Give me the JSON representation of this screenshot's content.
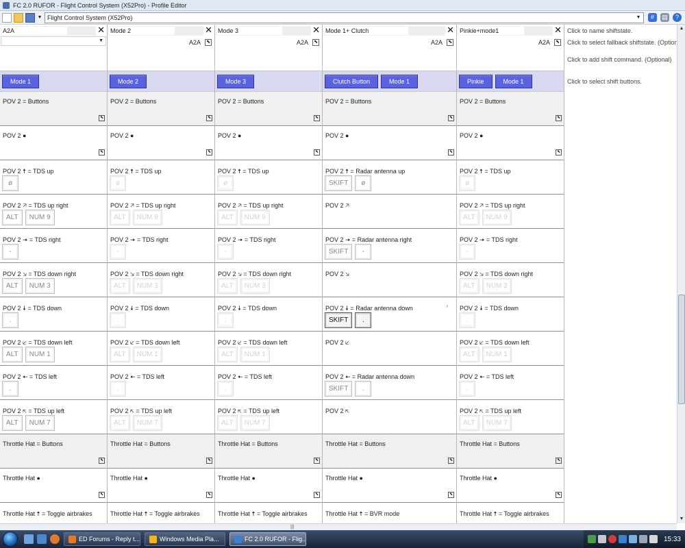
{
  "window": {
    "title": "FC 2.0 RUFOR - Flight Control System (X52Pro) - Profile Editor"
  },
  "toolbar": {
    "profile": "Flight Control System (X52Pro)",
    "icons": [
      "new-file-icon",
      "open-folder-icon",
      "save-icon",
      "dropdown-icon",
      "keyboard-icon",
      "print-icon",
      "help-icon"
    ]
  },
  "info": {
    "name": "Click to name shiftstate.",
    "fallback": "Click to select fallback shiftstate. (Optional)",
    "command": "Click to add shift command. (Optional)",
    "buttons": "Click to select shift buttons."
  },
  "columns": [
    {
      "name": "A2A",
      "fallback": "",
      "shift": [
        "Mode 1"
      ],
      "cells": [
        {
          "label": "POV 2 = Buttons",
          "keys": []
        },
        {
          "label": "POV 2 ●",
          "keys": []
        },
        {
          "label": "POV 2 🠅 = TDS up",
          "keys": [
            {
              "t": "ø",
              "s": "n"
            }
          ]
        },
        {
          "label": "POV 2 🡥 = TDS up right",
          "keys": [
            {
              "t": "ALT",
              "s": "n"
            },
            {
              "t": "NUM 9",
              "s": "n"
            }
          ]
        },
        {
          "label": "POV 2 🠆 = TDS right",
          "keys": [
            {
              "t": "-",
              "s": "n"
            }
          ]
        },
        {
          "label": "POV 2 🡦 = TDS down right",
          "keys": [
            {
              "t": "ALT",
              "s": "n"
            },
            {
              "t": "NUM 3",
              "s": "n"
            }
          ]
        },
        {
          "label": "POV 2 🠇 = TDS down",
          "keys": [
            {
              "t": ".",
              "s": "n"
            }
          ]
        },
        {
          "label": "POV 2 🡧 = TDS down left",
          "keys": [
            {
              "t": "ALT",
              "s": "n"
            },
            {
              "t": "NUM 1",
              "s": "n"
            }
          ]
        },
        {
          "label": "POV 2 🠄 = TDS left",
          "keys": [
            {
              "t": ".",
              "s": "n"
            }
          ]
        },
        {
          "label": "POV 2 🡤 = TDS up left",
          "keys": [
            {
              "t": "ALT",
              "s": "n"
            },
            {
              "t": "NUM 7",
              "s": "n"
            }
          ]
        },
        {
          "label": "Throttle Hat = Buttons",
          "keys": []
        },
        {
          "label": "Throttle Hat ●",
          "keys": []
        },
        {
          "label": "Throttle Hat 🠅 = Toggle airbrakes",
          "keys": []
        }
      ]
    },
    {
      "name": "Mode 2",
      "fallback": "A2A",
      "shift": [
        "Mode 2"
      ],
      "cells": [
        {
          "label": "POV 2 = Buttons",
          "keys": []
        },
        {
          "label": "POV 2 ●",
          "keys": []
        },
        {
          "label": "POV 2 🠅 = TDS up",
          "keys": [
            {
              "t": "ø",
              "s": "f"
            }
          ]
        },
        {
          "label": "POV 2 🡥 = TDS up right",
          "keys": [
            {
              "t": "ALT",
              "s": "f"
            },
            {
              "t": "NUM 9",
              "s": "f"
            }
          ]
        },
        {
          "label": "POV 2 🠆 = TDS right",
          "keys": [
            {
              "t": "-",
              "s": "f"
            }
          ]
        },
        {
          "label": "POV 2 🡦 = TDS down right",
          "keys": [
            {
              "t": "ALT",
              "s": "f"
            },
            {
              "t": "NUM 3",
              "s": "f"
            }
          ]
        },
        {
          "label": "POV 2 🠇 = TDS down",
          "keys": [
            {
              "t": ".",
              "s": "f"
            }
          ]
        },
        {
          "label": "POV 2 🡧 = TDS down left",
          "keys": [
            {
              "t": "ALT",
              "s": "f"
            },
            {
              "t": "NUM 1",
              "s": "f"
            }
          ]
        },
        {
          "label": "POV 2 🠄 = TDS left",
          "keys": [
            {
              "t": ".",
              "s": "f"
            }
          ]
        },
        {
          "label": "POV 2 🡤 = TDS up left",
          "keys": [
            {
              "t": "ALT",
              "s": "f"
            },
            {
              "t": "NUM 7",
              "s": "f"
            }
          ]
        },
        {
          "label": "Throttle Hat = Buttons",
          "keys": []
        },
        {
          "label": "Throttle Hat ●",
          "keys": []
        },
        {
          "label": "Throttle Hat 🠅 = Toggle airbrakes",
          "keys": []
        }
      ]
    },
    {
      "name": "Mode 3",
      "fallback": "A2A",
      "shift": [
        "Mode 3"
      ],
      "cells": [
        {
          "label": "POV 2 = Buttons",
          "keys": []
        },
        {
          "label": "POV 2 ●",
          "keys": []
        },
        {
          "label": "POV 2 🠅 = TDS up",
          "keys": [
            {
              "t": "ø",
              "s": "f"
            }
          ]
        },
        {
          "label": "POV 2 🡥 = TDS up right",
          "keys": [
            {
              "t": "ALT",
              "s": "f"
            },
            {
              "t": "NUM 9",
              "s": "f"
            }
          ]
        },
        {
          "label": "POV 2 🠆 = TDS right",
          "keys": [
            {
              "t": "-",
              "s": "f"
            }
          ]
        },
        {
          "label": "POV 2 🡦 = TDS down right",
          "keys": [
            {
              "t": "ALT",
              "s": "f"
            },
            {
              "t": "NUM 3",
              "s": "f"
            }
          ]
        },
        {
          "label": "POV 2 🠇 = TDS down",
          "keys": [
            {
              "t": ".",
              "s": "f"
            }
          ]
        },
        {
          "label": "POV 2 🡧 = TDS down left",
          "keys": [
            {
              "t": "ALT",
              "s": "f"
            },
            {
              "t": "NUM 1",
              "s": "f"
            }
          ]
        },
        {
          "label": "POV 2 🠄 = TDS left",
          "keys": [
            {
              "t": ".",
              "s": "f"
            }
          ]
        },
        {
          "label": "POV 2 🡤 = TDS up left",
          "keys": [
            {
              "t": "ALT",
              "s": "f"
            },
            {
              "t": "NUM 7",
              "s": "f"
            }
          ]
        },
        {
          "label": "Throttle Hat = Buttons",
          "keys": []
        },
        {
          "label": "Throttle Hat ●",
          "keys": []
        },
        {
          "label": "Throttle Hat 🠅 = Toggle airbrakes",
          "keys": []
        }
      ]
    },
    {
      "name": "Mode 1+ Clutch",
      "fallback": "A2A",
      "shift": [
        "Clutch Button",
        "Mode 1"
      ],
      "cells": [
        {
          "label": "POV 2 = Buttons",
          "keys": []
        },
        {
          "label": "POV 2 ●",
          "keys": []
        },
        {
          "label": "POV 2 🠅 = Radar antenna up",
          "keys": [
            {
              "t": "SKIFT",
              "s": "n"
            },
            {
              "t": "ø",
              "s": "n"
            }
          ]
        },
        {
          "label": "POV 2 🡥",
          "keys": []
        },
        {
          "label": "POV 2 🠆 = Radar antenna right",
          "keys": [
            {
              "t": "SKIFT",
              "s": "n"
            },
            {
              "t": "-",
              "s": "n"
            }
          ]
        },
        {
          "label": "POV 2 🡦",
          "keys": []
        },
        {
          "label": "POV 2 🠇 = Radar antenna down",
          "keys": [
            {
              "t": "SKIFT",
              "s": "b"
            },
            {
              "t": ".",
              "s": "b"
            }
          ],
          "hint": "›"
        },
        {
          "label": "POV 2 🡧",
          "keys": []
        },
        {
          "label": "POV 2 🠄 = Radar antenna down",
          "keys": [
            {
              "t": "SKIFT",
              "s": "n"
            },
            {
              "t": ".",
              "s": "n"
            }
          ]
        },
        {
          "label": "POV 2 🡤",
          "keys": []
        },
        {
          "label": "Throttle Hat = Buttons",
          "keys": []
        },
        {
          "label": "Throttle Hat ●",
          "keys": []
        },
        {
          "label": "Throttle Hat 🠅 = BVR mode",
          "keys": []
        }
      ]
    },
    {
      "name": "Pinkie+mode1",
      "fallback": "A2A",
      "shift": [
        "Pinkie",
        "Mode 1"
      ],
      "cells": [
        {
          "label": "POV 2 = Buttons",
          "keys": []
        },
        {
          "label": "POV 2 ●",
          "keys": []
        },
        {
          "label": "POV 2 🠅 = TDS up",
          "keys": [
            {
              "t": "ø",
              "s": "f"
            }
          ]
        },
        {
          "label": "POV 2 🡥 = TDS up right",
          "keys": [
            {
              "t": "ALT",
              "s": "f"
            },
            {
              "t": "NUM 9",
              "s": "f"
            }
          ]
        },
        {
          "label": "POV 2 🠆 = TDS right",
          "keys": [
            {
              "t": "-",
              "s": "f"
            }
          ]
        },
        {
          "label": "POV 2 🡦 = TDS down right",
          "keys": [
            {
              "t": "ALT",
              "s": "f"
            },
            {
              "t": "NUM 3",
              "s": "f"
            }
          ]
        },
        {
          "label": "POV 2 🠇 = TDS down",
          "keys": [
            {
              "t": ".",
              "s": "f"
            }
          ]
        },
        {
          "label": "POV 2 🡧 = TDS down left",
          "keys": [
            {
              "t": "ALT",
              "s": "f"
            },
            {
              "t": "NUM 1",
              "s": "f"
            }
          ]
        },
        {
          "label": "POV 2 🠄 = TDS left",
          "keys": [
            {
              "t": ".",
              "s": "f"
            }
          ]
        },
        {
          "label": "POV 2 🡤 = TDS up left",
          "keys": [
            {
              "t": "ALT",
              "s": "f"
            },
            {
              "t": "NUM 7",
              "s": "f"
            }
          ]
        },
        {
          "label": "Throttle Hat = Buttons",
          "keys": []
        },
        {
          "label": "Throttle Hat ●",
          "keys": []
        },
        {
          "label": "Throttle Hat 🠅 = Toggle airbrakes",
          "keys": []
        }
      ]
    }
  ],
  "taskbar": {
    "tasks": [
      {
        "label": "ED Forums - Reply t...",
        "active": false
      },
      {
        "label": "Windows Media Pla...",
        "active": false
      },
      {
        "label": "FC 2.0 RUFOR - Flig...",
        "active": true
      }
    ],
    "clock": "15:33"
  },
  "colors": {
    "shift_button": "#5b62e0",
    "shift_row": "#d8d8f0",
    "header_cell": "#f0f0f0"
  }
}
